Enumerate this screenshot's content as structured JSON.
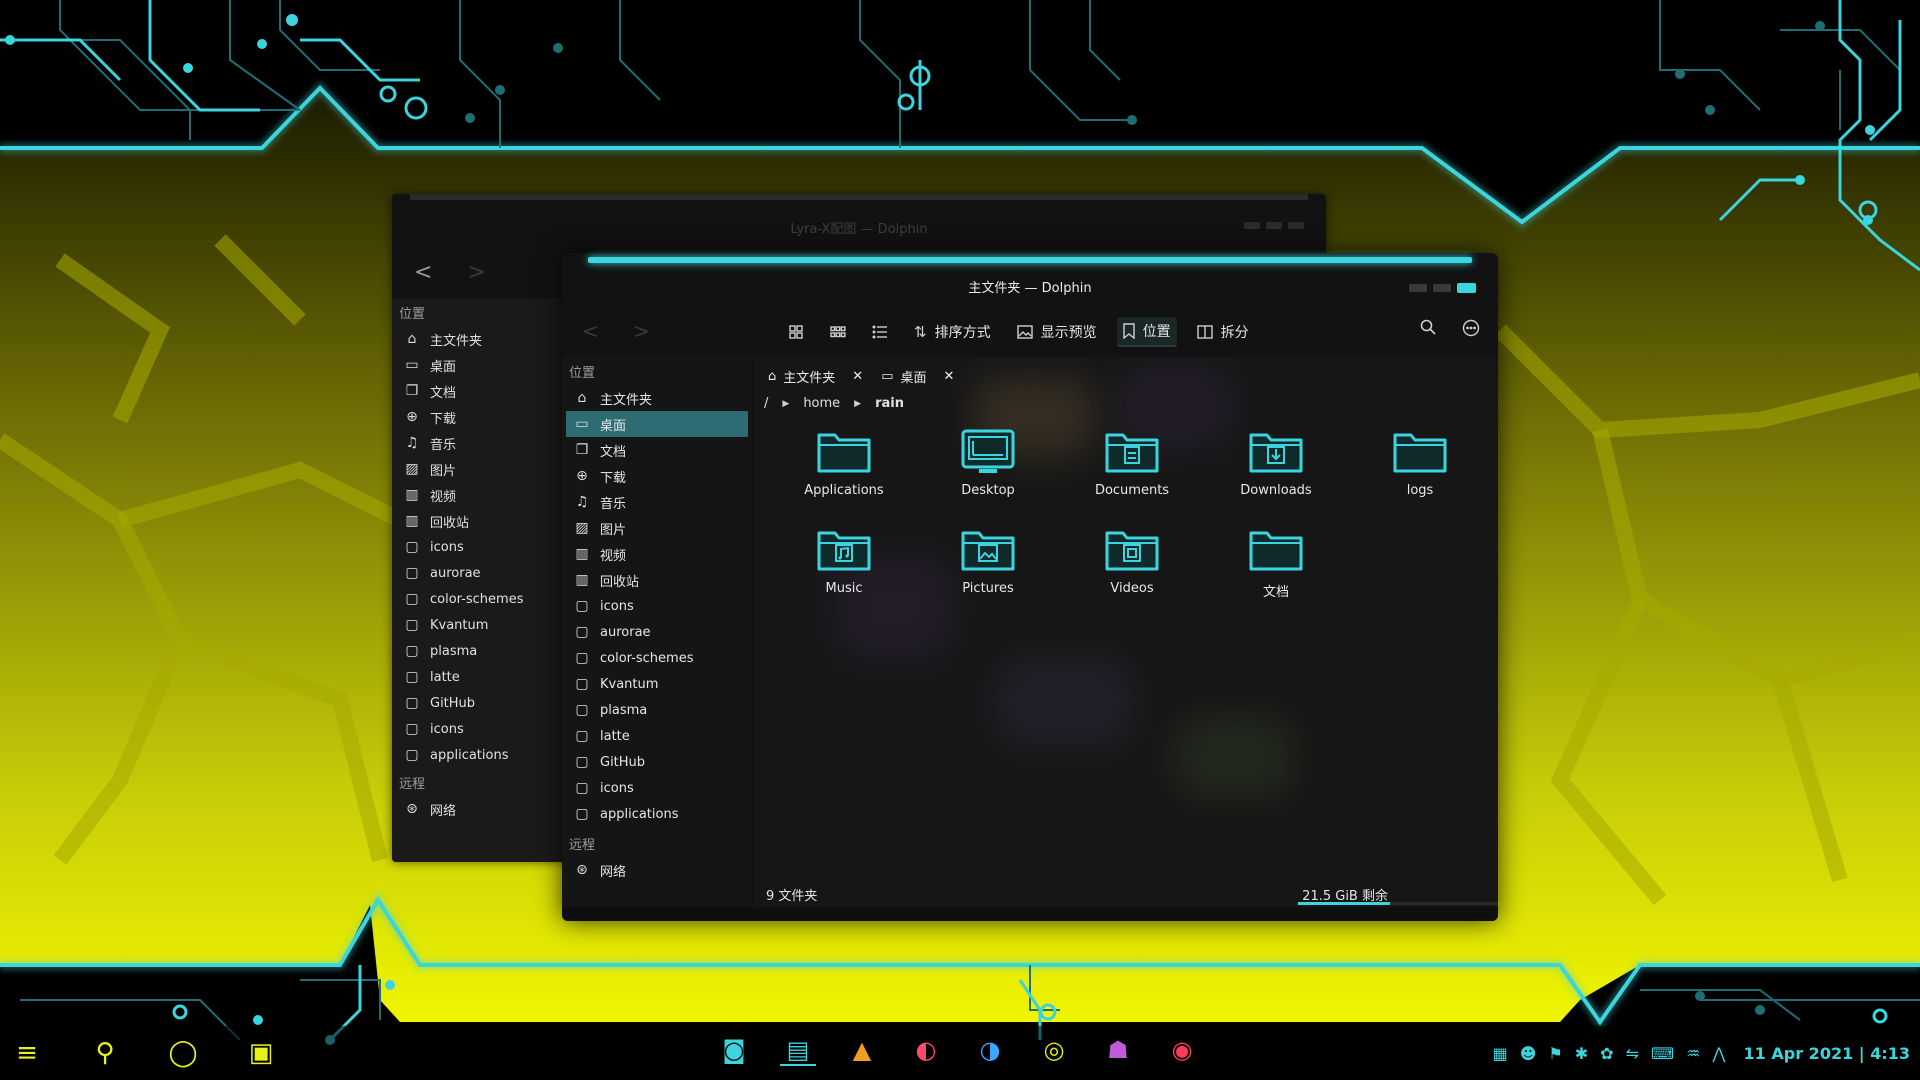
{
  "wallpaper": {
    "accent": "#3ad5de",
    "yellow": "#e6ef00"
  },
  "back_window": {
    "title": "Lyra-X配图 — Dolphin",
    "nav": {
      "back": "<",
      "forward": ">"
    },
    "sidebar": {
      "places_header": "位置",
      "places": [
        {
          "label": "主文件夹",
          "icon": "home-icon"
        },
        {
          "label": "桌面",
          "icon": "desktop-icon"
        },
        {
          "label": "文档",
          "icon": "documents-icon"
        },
        {
          "label": "下载",
          "icon": "download-icon"
        },
        {
          "label": "音乐",
          "icon": "music-icon"
        },
        {
          "label": "图片",
          "icon": "image-icon"
        },
        {
          "label": "视频",
          "icon": "video-icon"
        },
        {
          "label": "回收站",
          "icon": "trash-icon"
        },
        {
          "label": "icons",
          "icon": "folder-icon"
        },
        {
          "label": "aurorae",
          "icon": "folder-icon"
        },
        {
          "label": "color-schemes",
          "icon": "folder-icon"
        },
        {
          "label": "Kvantum",
          "icon": "folder-icon"
        },
        {
          "label": "plasma",
          "icon": "folder-icon"
        },
        {
          "label": "latte",
          "icon": "folder-icon"
        },
        {
          "label": "GitHub",
          "icon": "folder-icon"
        },
        {
          "label": "icons",
          "icon": "folder-icon"
        },
        {
          "label": "applications",
          "icon": "folder-icon"
        }
      ],
      "remote_header": "远程",
      "remote": [
        {
          "label": "网络",
          "icon": "network-icon"
        }
      ]
    }
  },
  "window": {
    "title": "主文件夹 — Dolphin",
    "nav": {
      "back": "<",
      "forward": ">"
    },
    "toolbar": {
      "sort_label": "排序方式",
      "preview_label": "显示预览",
      "places_label": "位置",
      "split_label": "拆分"
    },
    "sidebar": {
      "places_header": "位置",
      "places": [
        {
          "label": "主文件夹",
          "icon": "home-icon"
        },
        {
          "label": "桌面",
          "icon": "desktop-icon",
          "selected": true
        },
        {
          "label": "文档",
          "icon": "documents-icon"
        },
        {
          "label": "下载",
          "icon": "download-icon"
        },
        {
          "label": "音乐",
          "icon": "music-icon"
        },
        {
          "label": "图片",
          "icon": "image-icon"
        },
        {
          "label": "视频",
          "icon": "video-icon"
        },
        {
          "label": "回收站",
          "icon": "trash-icon"
        },
        {
          "label": "icons",
          "icon": "folder-icon"
        },
        {
          "label": "aurorae",
          "icon": "folder-icon"
        },
        {
          "label": "color-schemes",
          "icon": "folder-icon"
        },
        {
          "label": "Kvantum",
          "icon": "folder-icon"
        },
        {
          "label": "plasma",
          "icon": "folder-icon"
        },
        {
          "label": "latte",
          "icon": "folder-icon"
        },
        {
          "label": "GitHub",
          "icon": "folder-icon"
        },
        {
          "label": "icons",
          "icon": "folder-icon"
        },
        {
          "label": "applications",
          "icon": "folder-icon"
        }
      ],
      "remote_header": "远程",
      "remote": [
        {
          "label": "网络",
          "icon": "network-icon"
        }
      ]
    },
    "tabs": [
      {
        "label": "主文件夹",
        "icon": "home-icon"
      },
      {
        "label": "桌面",
        "icon": "desktop-icon"
      }
    ],
    "breadcrumb": {
      "root": "/",
      "parts": [
        "home",
        "rain"
      ]
    },
    "files": [
      {
        "label": "Applications",
        "kind": "folder"
      },
      {
        "label": "Desktop",
        "kind": "desktop"
      },
      {
        "label": "Documents",
        "kind": "documents"
      },
      {
        "label": "Downloads",
        "kind": "downloads"
      },
      {
        "label": "logs",
        "kind": "folder"
      },
      {
        "label": "Music",
        "kind": "music"
      },
      {
        "label": "Pictures",
        "kind": "pictures"
      },
      {
        "label": "Videos",
        "kind": "videos"
      },
      {
        "label": "文档",
        "kind": "folder"
      }
    ],
    "status": {
      "count": "9 文件夹",
      "free": "21.5 GiB 剩余",
      "usage_fraction": 0.46
    }
  },
  "taskbar": {
    "left": [
      "menu-icon",
      "search-icon",
      "circle-icon",
      "overview-icon"
    ],
    "apps": [
      "screenshot-icon",
      "file-manager-icon",
      "inkscape-icon",
      "firefox-icon",
      "edge-icon",
      "theme-icon",
      "github-icon",
      "music-player-icon"
    ],
    "tray": [
      "package-icon",
      "robot-icon",
      "broom-icon",
      "bluetooth-icon",
      "weather-icon",
      "network-icon",
      "keyboard-icon",
      "audio-icon",
      "arrow-icon"
    ],
    "clock": "11 Apr 2021 | 4:13"
  }
}
